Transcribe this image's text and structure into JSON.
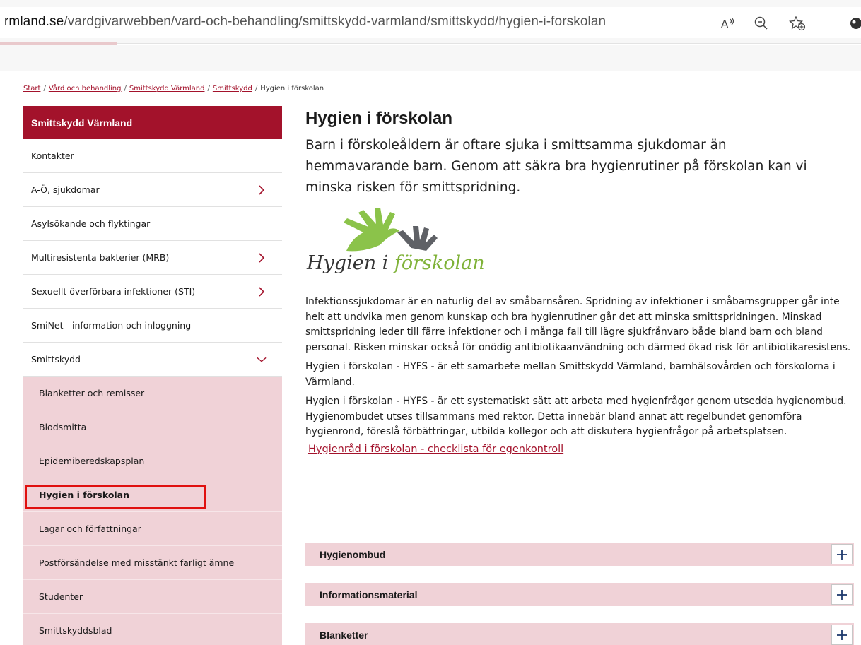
{
  "browser": {
    "url_host": "rmland.se",
    "url_path": "/vardgivarwebben/vard-och-behandling/smittskydd-varmland/smittskydd/hygien-i-forskolan"
  },
  "breadcrumb": [
    {
      "label": "Start",
      "link": true
    },
    {
      "label": "Vård och behandling",
      "link": true
    },
    {
      "label": "Smittskydd Värmland",
      "link": true
    },
    {
      "label": "Smittskydd",
      "link": true
    },
    {
      "label": "Hygien i förskolan",
      "link": false
    }
  ],
  "sidebar": {
    "heading": "Smittskydd Värmland",
    "items": [
      {
        "label": "Kontakter",
        "chevron": "none"
      },
      {
        "label": "A-Ö, sjukdomar",
        "chevron": "right"
      },
      {
        "label": "Asylsökande och flyktingar",
        "chevron": "none"
      },
      {
        "label": "Multiresistenta bakterier (MRB)",
        "chevron": "right"
      },
      {
        "label": "Sexuellt överförbara infektioner (STI)",
        "chevron": "right"
      },
      {
        "label": "SmiNet - information och inloggning",
        "chevron": "none"
      },
      {
        "label": "Smittskydd",
        "chevron": "down"
      }
    ],
    "subitems": [
      {
        "label": "Blanketter och remisser",
        "current": false
      },
      {
        "label": "Blodsmitta",
        "current": false
      },
      {
        "label": "Epidemiberedskapsplan",
        "current": false
      },
      {
        "label": "Hygien i förskolan",
        "current": true
      },
      {
        "label": "Lagar och författningar",
        "current": false
      },
      {
        "label": "Postförsändelse med misstänkt farligt ämne",
        "current": false
      },
      {
        "label": "Studenter",
        "current": false
      },
      {
        "label": "Smittskyddsblad",
        "current": false
      }
    ]
  },
  "main": {
    "title": "Hygien i förskolan",
    "lead": "Barn i förskoleåldern är oftare sjuka i smittsamma sjukdomar än hemmavarande barn. Genom att säkra bra hygienrutiner på förskolan kan vi minska risken för smittspridning.",
    "logo": {
      "text_1": "Hygien i ",
      "text_2": "förskolan"
    },
    "paragraphs": [
      "Infektionssjukdomar är en naturlig del av småbarnsåren. Spridning av infektioner i småbarnsgrupper går inte helt att undvika men genom kunskap och bra hygienrutiner går det att minska smittspridningen. Minskad smittspridning leder till färre infektioner och i många fall till lägre sjukfrånvaro både bland barn och bland personal. Risken minskar också för onödig antibiotikaanvändning och därmed ökad risk för antibiotikaresistens.",
      "Hygien i förskolan - HYFS - är ett samarbete mellan Smittskydd Värmland, barnhälsovården och förskolorna i Värmland.",
      "Hygien i förskolan - HYFS - är ett systematiskt sätt att arbeta med hygienfrågor genom utsedda hygienombud. Hygienombudet utses tillsammans med rektor. Detta innebär bland annat att regelbundet genomföra hygienrond, föreslå förbättringar, utbilda kollegor och att diskutera hygienfrågor på arbetsplatsen."
    ],
    "link": "Hygienråd i förskolan - checklista för egenkontroll",
    "accordions": [
      "Hygienombud",
      "Informationsmaterial",
      "Blanketter"
    ]
  },
  "colors": {
    "brand": "#a3122b",
    "sub_bg": "#f0d2d7",
    "highlight": "#e0100f"
  },
  "icons": [
    "read-aloud-icon",
    "zoom-out-icon",
    "favorites-icon",
    "browser-extension-icon",
    "chevron-right-icon",
    "chevron-down-icon",
    "plus-icon"
  ]
}
